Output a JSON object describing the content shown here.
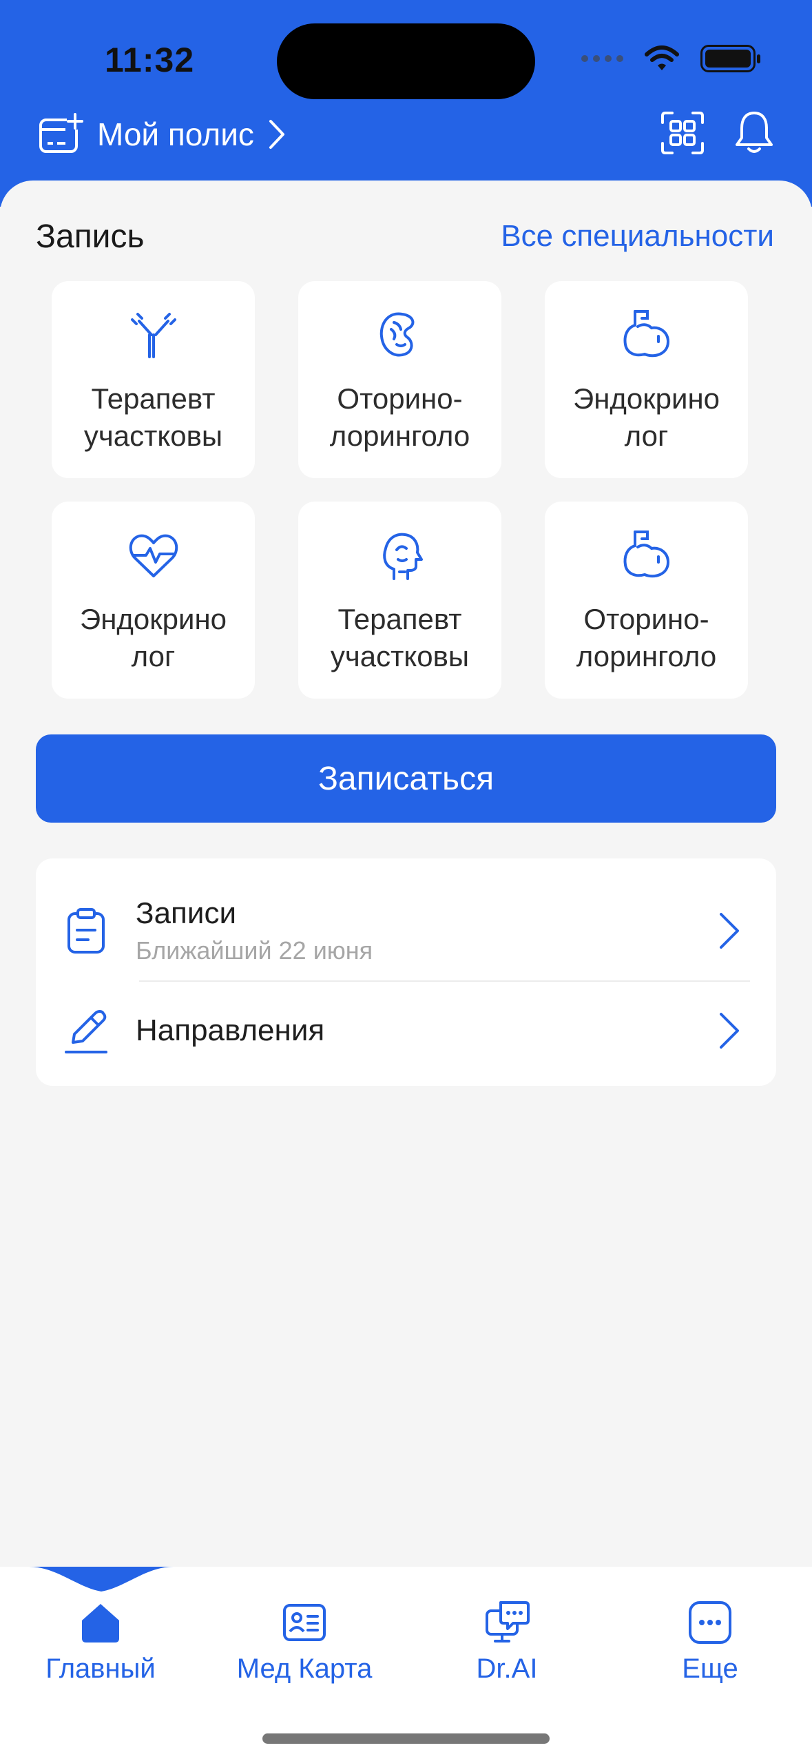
{
  "status_bar": {
    "time": "11:32"
  },
  "header": {
    "policy_label": "Мой полис"
  },
  "booking": {
    "title": "Запись",
    "all_link": "Все специальности",
    "tiles": [
      {
        "icon": "antibody-icon",
        "label": "Терапевт\nучастковы"
      },
      {
        "icon": "kidney-icon",
        "label": "Оторино-\nлоринголо"
      },
      {
        "icon": "stomach-icon",
        "label": "Эндокрино\nлог"
      },
      {
        "icon": "heart-pulse-icon",
        "label": "Эндокрино\nлог"
      },
      {
        "icon": "head-profile-icon",
        "label": "Терапевт\nучастковы"
      },
      {
        "icon": "stomach-icon",
        "label": "Оторино-\nлоринголо"
      }
    ],
    "cta_label": "Записаться"
  },
  "list": {
    "appointments": {
      "title": "Записи",
      "subtitle": "Ближайший 22 июня"
    },
    "referrals": {
      "title": "Направления"
    }
  },
  "tabbar": {
    "tabs": [
      {
        "label": "Главный",
        "icon": "home-icon",
        "active": true
      },
      {
        "label": "Мед Карта",
        "icon": "id-card-icon",
        "active": false
      },
      {
        "label": "Dr.AI",
        "icon": "chat-monitor-icon",
        "active": false
      },
      {
        "label": "Еще",
        "icon": "more-icon",
        "active": false
      }
    ]
  },
  "colors": {
    "accent": "#2463e6",
    "background": "#f5f5f5",
    "card": "#ffffff"
  }
}
